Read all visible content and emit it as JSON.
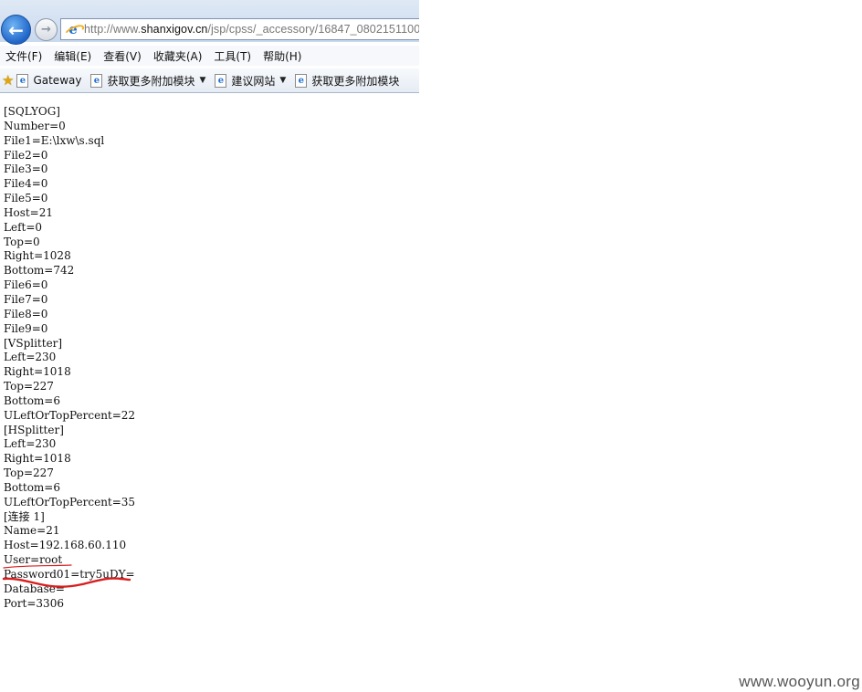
{
  "browser": {
    "url_prefix": "http://www.",
    "url_host": "shanxigov.cn",
    "url_path": "/jsp/cpss/_accessory/16847_0802151100"
  },
  "menubar": [
    {
      "label": "文件(F)"
    },
    {
      "label": "编辑(E)"
    },
    {
      "label": "查看(V)"
    },
    {
      "label": "收藏夹(A)"
    },
    {
      "label": "工具(T)"
    },
    {
      "label": "帮助(H)"
    }
  ],
  "favorites": [
    {
      "label": "Gateway",
      "dropdown": false
    },
    {
      "label": "获取更多附加模块",
      "dropdown": true
    },
    {
      "label": "建议网站",
      "dropdown": true
    },
    {
      "label": "获取更多附加模块",
      "dropdown": false
    }
  ],
  "content_lines": [
    "[SQLYOG]",
    "Number=0",
    "File1=E:\\lxw\\s.sql",
    "File2=0",
    "File3=0",
    "File4=0",
    "File5=0",
    "Host=21",
    "Left=0",
    "Top=0",
    "Right=1028",
    "Bottom=742",
    "File6=0",
    "File7=0",
    "File8=0",
    "File9=0",
    "[VSplitter]",
    "Left=230",
    "Right=1018",
    "Top=227",
    "Bottom=6",
    "ULeftOrTopPercent=22",
    "[HSplitter]",
    "Left=230",
    "Right=1018",
    "Top=227",
    "Bottom=6",
    "ULeftOrTopPercent=35",
    "[连接 1]",
    "Name=21",
    "Host=192.168.60.110",
    "User=root",
    "Password01=try5uDY=",
    "Database=",
    "Port=3306"
  ],
  "watermark": "www.wooyun.org",
  "colors": {
    "annotation": "#d81e1e"
  }
}
